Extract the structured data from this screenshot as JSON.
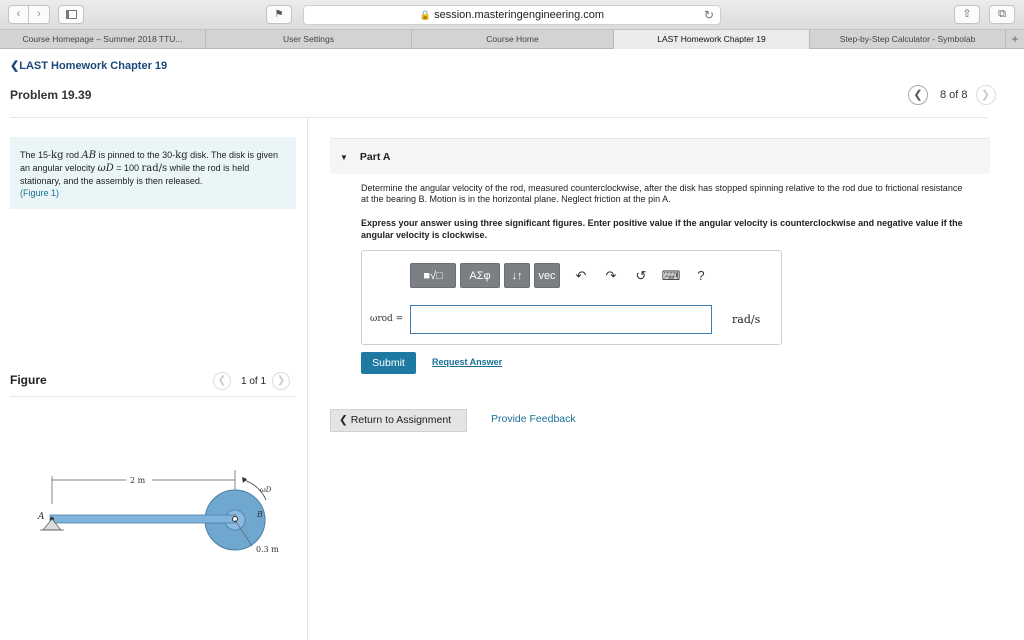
{
  "browser": {
    "url": "session.masteringengineering.com",
    "tabs": [
      {
        "label": "Course Homepage – Summer 2018 TTU..."
      },
      {
        "label": "User Settings"
      },
      {
        "label": "Course Home"
      },
      {
        "label": "LAST Homework Chapter 19"
      },
      {
        "label": "Step-by-Step Calculator - Symbolab"
      }
    ],
    "new_tab": "+"
  },
  "page": {
    "breadcrumb": "LAST Homework Chapter 19",
    "problem_title": "Problem 19.39",
    "pager": {
      "text": "8 of 8"
    }
  },
  "problem": {
    "t1": "The 15-",
    "kg1": "kg",
    "t2": " rod ",
    "ab": "AB",
    "t3": " is pinned to the 30-",
    "kg2": "kg",
    "t4": " disk. The disk is given an angular velocity ",
    "omega": "ωD",
    "t5": " = 100 ",
    "rads": "rad/s",
    "t6": " while the rod is held stationary, and the assembly is then released.",
    "figure_link": "(Figure 1)"
  },
  "figure": {
    "heading": "Figure",
    "pager_text": "1 of 1",
    "dim_top": "2 m",
    "dim_r": "0.3 m",
    "label_a": "A",
    "label_b": "B",
    "label_omega": "ωD"
  },
  "part": {
    "label": "Part A",
    "question": "Determine the angular velocity of the rod, measured counterclockwise, after the disk has stopped spinning relative to the rod due to frictional resistance at the bearing B. Motion is in the horizontal plane. Neglect friction at the pin A.",
    "instruction": "Express your answer using three significant figures. Enter positive value if the angular velocity is counterclockwise and negative value if the angular velocity is clockwise."
  },
  "answer": {
    "var_label": "ωrod =",
    "input_value": "",
    "unit": "rad/s",
    "toolbar": {
      "templates": "■√□",
      "symbols": "ΑΣφ",
      "arrows": "↓↑",
      "vec": "vec",
      "help": "?"
    }
  },
  "actions": {
    "submit": "Submit",
    "request_answer": "Request Answer",
    "return": "Return to Assignment",
    "feedback": "Provide Feedback"
  }
}
